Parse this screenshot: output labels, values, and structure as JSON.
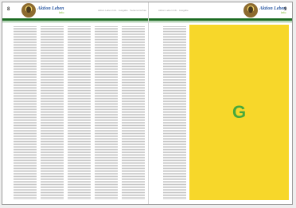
{
  "pages": {
    "left": {
      "page_number": "8",
      "logo_name": "Aktion Leben",
      "logo_sub": "Info",
      "header_caption": "Aktion Leben Info · Ausgabe · Seitenvorschau"
    },
    "right": {
      "page_number": "9",
      "logo_name": "Aktion Leben",
      "logo_sub": "Info",
      "header_caption": "Aktion Leben Info · Ausgabe"
    }
  },
  "feature": {
    "letter": "G",
    "colors": {
      "box": "#f7d72a",
      "letter": "#47a83d",
      "rule": "#1b6b22"
    }
  }
}
